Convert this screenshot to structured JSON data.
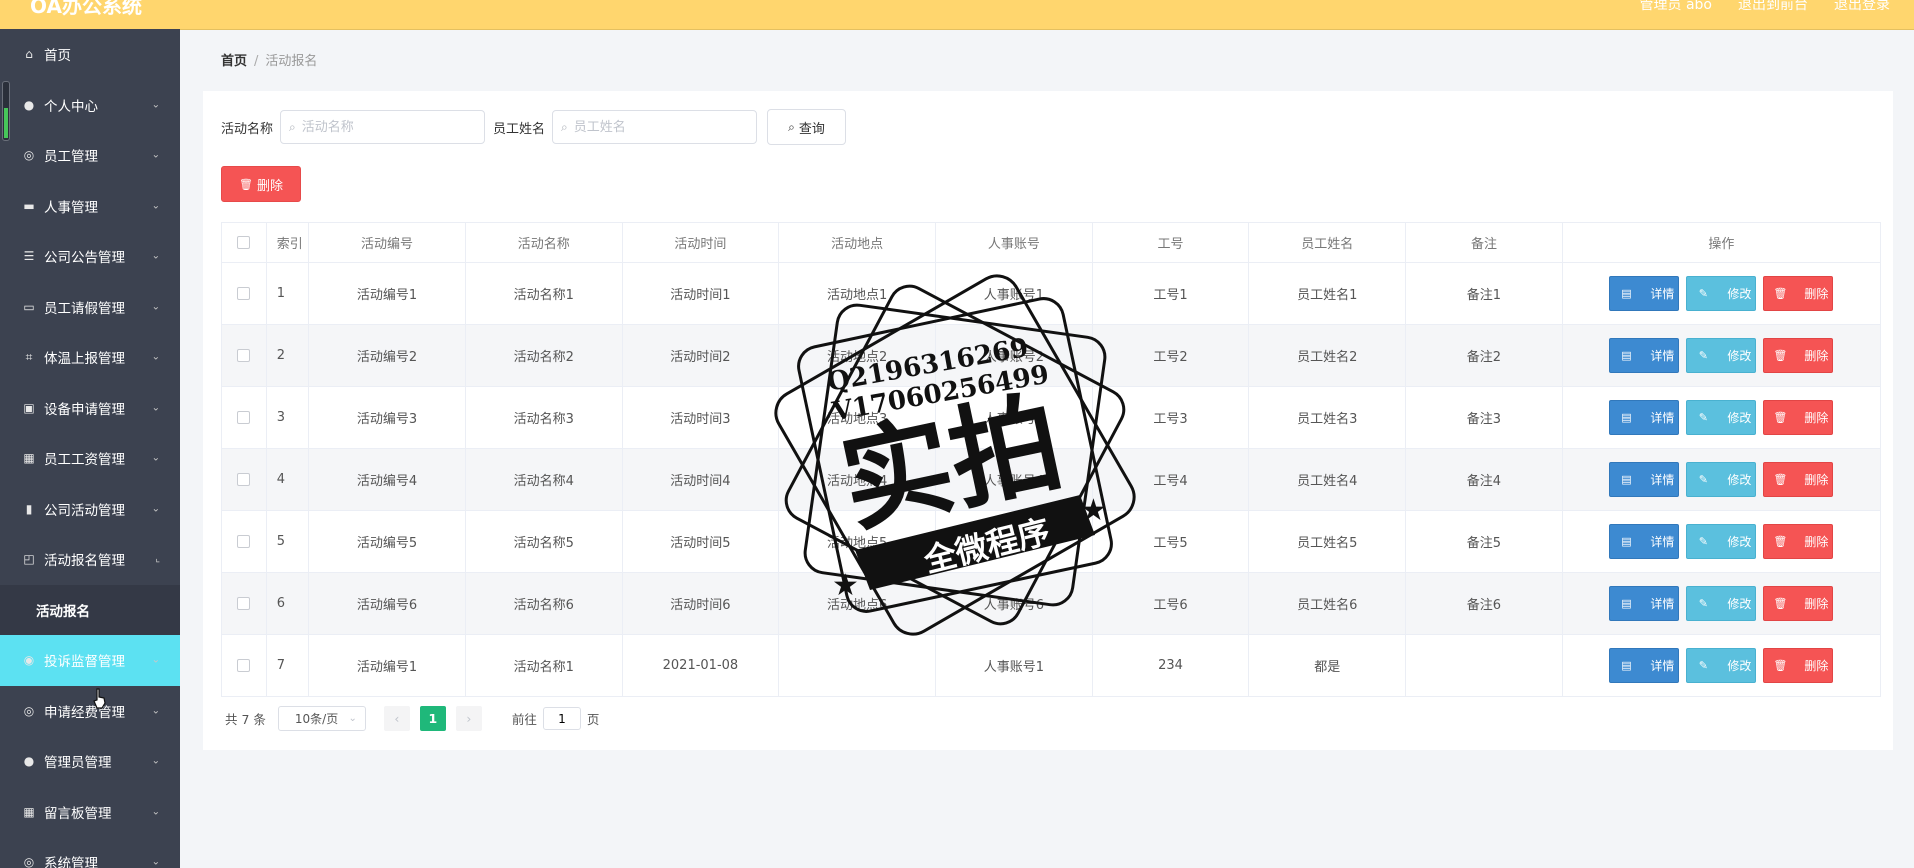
{
  "app": {
    "logo": "OA办公系统",
    "header_links": [
      "管理员 abo",
      "退出到前台",
      "退出登录"
    ]
  },
  "sidebar": {
    "items": [
      {
        "label": "首页",
        "icon": "home-icon",
        "glyph": "⌂",
        "arrow": ""
      },
      {
        "label": "个人中心",
        "icon": "user-icon",
        "glyph": "●",
        "arrow": "⌄"
      },
      {
        "label": "员工管理",
        "icon": "compass-icon",
        "glyph": "◎",
        "arrow": "⌄"
      },
      {
        "label": "人事管理",
        "icon": "drive-icon",
        "glyph": "▬",
        "arrow": "⌄"
      },
      {
        "label": "公司公告管理",
        "icon": "list-icon",
        "glyph": "☰",
        "arrow": "⌄"
      },
      {
        "label": "员工请假管理",
        "icon": "chat-icon",
        "glyph": "▭",
        "arrow": "⌄"
      },
      {
        "label": "体温上报管理",
        "icon": "crop-icon",
        "glyph": "⌗",
        "arrow": "⌄"
      },
      {
        "label": "设备申请管理",
        "icon": "toolbox-icon",
        "glyph": "▣",
        "arrow": "⌄"
      },
      {
        "label": "员工工资管理",
        "icon": "grid-icon",
        "glyph": "▦",
        "arrow": "⌄"
      },
      {
        "label": "公司活动管理",
        "icon": "bar-chart-icon",
        "glyph": "▮",
        "arrow": "⌄"
      },
      {
        "label": "活动报名管理",
        "icon": "chart-line-icon",
        "glyph": "◰",
        "arrow": "⌞"
      },
      {
        "label": "活动报名",
        "sub": true
      },
      {
        "label": "投诉监督管理",
        "icon": "target-icon",
        "glyph": "◉",
        "arrow": "⌄",
        "active": true
      },
      {
        "label": "申请经费管理",
        "icon": "coin-icon",
        "glyph": "◎",
        "arrow": "⌄"
      },
      {
        "label": "管理员管理",
        "icon": "pin-icon",
        "glyph": "●",
        "arrow": "⌄"
      },
      {
        "label": "留言板管理",
        "icon": "apps-icon",
        "glyph": "▦",
        "arrow": "⌄"
      },
      {
        "label": "系统管理",
        "icon": "settings-icon",
        "glyph": "◎",
        "arrow": "⌄"
      }
    ]
  },
  "breadcrumb": {
    "home": "首页",
    "current": "活动报名"
  },
  "filter": {
    "name_label": "活动名称",
    "name_placeholder": "活动名称",
    "staff_label": "员工姓名",
    "staff_placeholder": "员工姓名",
    "query_button": "查询",
    "delete_button": "删除"
  },
  "table": {
    "headers": [
      "索引",
      "活动编号",
      "活动名称",
      "活动时间",
      "活动地点",
      "人事账号",
      "工号",
      "员工姓名",
      "备注",
      "操作"
    ],
    "rows": [
      {
        "idx": "1",
        "code": "活动编号1",
        "name": "活动名称1",
        "time": "活动时间1",
        "place": "活动地点1",
        "account": "人事账号1",
        "no": "工号1",
        "staff": "员工姓名1",
        "note": "备注1"
      },
      {
        "idx": "2",
        "code": "活动编号2",
        "name": "活动名称2",
        "time": "活动时间2",
        "place": "活动地点2",
        "account": "人事账号2",
        "no": "工号2",
        "staff": "员工姓名2",
        "note": "备注2"
      },
      {
        "idx": "3",
        "code": "活动编号3",
        "name": "活动名称3",
        "time": "活动时间3",
        "place": "活动地点3",
        "account": "人事账号3",
        "no": "工号3",
        "staff": "员工姓名3",
        "note": "备注3"
      },
      {
        "idx": "4",
        "code": "活动编号4",
        "name": "活动名称4",
        "time": "活动时间4",
        "place": "活动地点4",
        "account": "人事账号4",
        "no": "工号4",
        "staff": "员工姓名4",
        "note": "备注4"
      },
      {
        "idx": "5",
        "code": "活动编号5",
        "name": "活动名称5",
        "time": "活动时间5",
        "place": "活动地点5",
        "account": "人事账号5",
        "no": "工号5",
        "staff": "员工姓名5",
        "note": "备注5"
      },
      {
        "idx": "6",
        "code": "活动编号6",
        "name": "活动名称6",
        "time": "活动时间6",
        "place": "活动地点6",
        "account": "人事账号6",
        "no": "工号6",
        "staff": "员工姓名6",
        "note": "备注6"
      },
      {
        "idx": "7",
        "code": "活动编号1",
        "name": "活动名称1",
        "time": "2021-01-08",
        "place": "",
        "account": "人事账号1",
        "no": "234",
        "staff": "都是",
        "note": ""
      }
    ],
    "actions": {
      "detail": "详情",
      "edit": "修改",
      "remove": "删除"
    }
  },
  "pagination": {
    "total": "共 7 条",
    "page_size": "10条/页",
    "current_page": "1",
    "goto_label": "前往",
    "goto_value": "1",
    "page_unit": "页"
  },
  "watermark": {
    "line1": "Q2196316269",
    "line2": "V17060256499",
    "big": "实拍",
    "banner": "全微程序"
  },
  "colors": {
    "header": "#ffd66e",
    "sidebar": "#3c4250",
    "active_menu": "#5ce1f2",
    "detail_btn": "#3d8ad1",
    "edit_btn": "#5bc0de",
    "delete_btn": "#f55454",
    "page_active": "#1fb87a"
  }
}
